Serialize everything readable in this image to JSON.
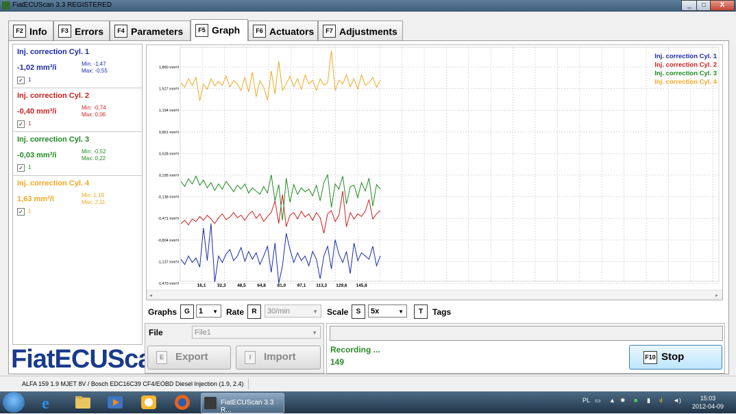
{
  "window": {
    "title": "FiatECUScan 3.3 REGISTERED",
    "minimize": "_",
    "maximize": "□",
    "close": "X"
  },
  "tabs": [
    {
      "key": "F2",
      "label": "Info"
    },
    {
      "key": "F3",
      "label": "Errors"
    },
    {
      "key": "F4",
      "label": "Parameters"
    },
    {
      "key": "F5",
      "label": "Graph",
      "active": true
    },
    {
      "key": "F6",
      "label": "Actuators"
    },
    {
      "key": "F7",
      "label": "Adjustments"
    }
  ],
  "cylinders": [
    {
      "name": "Inj. correction Cyl. 1",
      "value": "-1,02 mm³/i",
      "min": "Min: -1,47",
      "max": "Max: -0,55",
      "graph": "1",
      "color": "#1a2aaa"
    },
    {
      "name": "Inj. correction Cyl. 2",
      "value": "-0,40 mm³/i",
      "min": "Min: -0,74",
      "max": "Max: 0,06",
      "graph": "1",
      "color": "#cc2020"
    },
    {
      "name": "Inj. correction Cyl. 3",
      "value": "-0,03 mm³/i",
      "min": "Min: -0,52",
      "max": "Max: 0,22",
      "graph": "1",
      "color": "#1f8a1f"
    },
    {
      "name": "Inj. correction Cyl. 4",
      "value": "1,63 mm³/i",
      "min": "Min: 1,19",
      "max": "Max: 2,11",
      "graph": "1",
      "color": "#f0a820"
    }
  ],
  "logo": "FiatECUScan",
  "controls": {
    "graphs_label": "Graphs",
    "graphs_key": "G",
    "graphs_value": "1",
    "rate_label": "Rate",
    "rate_key": "R",
    "rate_value": "30/min",
    "scale_label": "Scale",
    "scale_key": "S",
    "scale_value": "5x",
    "tags_key": "T",
    "tags_label": "Tags"
  },
  "file": {
    "label": "File",
    "value": "File1",
    "export_key": "E",
    "export_label": "Export",
    "import_key": "I",
    "import_label": "Import"
  },
  "recording": {
    "text": "Recording ...",
    "count": "149",
    "stop_key": "F10",
    "stop_label": "Stop"
  },
  "status": "ALFA 159 1.9 MJET 8V / Bosch EDC16C39 CF4/EOBD Diesel Injection (1.9, 2.4)",
  "taskbar": {
    "app_label": "FiatECUScan 3.3 R...",
    "lang": "PL",
    "time": "15:03",
    "date": "2012-04-09"
  },
  "chart_data": {
    "type": "line",
    "y_ticks": [
      "1,860 mm³/i",
      "1,527 mm³/i",
      "1,194 mm³/i",
      "0,861 mm³/i",
      "0,528 mm³/i",
      "0,195 mm³/i",
      "-0,138 mm³/i",
      "-0,471 mm³/i",
      "-0,804 mm³/i",
      "-1,137 mm³/i",
      "-1,470 mm³/i"
    ],
    "x_ticks": [
      "16,1",
      "32,3",
      "48,5",
      "64,8",
      "81,0",
      "97,1",
      "113,3",
      "129,6",
      "145,8"
    ],
    "ylim": [
      -1.47,
      2.193
    ],
    "xlim": [
      0,
      600
    ],
    "legend_position": "top-right",
    "grid": true,
    "series": [
      {
        "name": "Inj. correction Cyl. 1",
        "color": "#1a2aaa",
        "values": [
          -1.1,
          -1.18,
          -1.05,
          -1.15,
          -1.08,
          -1.22,
          -0.62,
          -1.12,
          -0.55,
          -1.45,
          -1.05,
          -1.15,
          -1.02,
          -0.95,
          -1.12,
          -1.05,
          -0.92,
          -1.13,
          -0.98,
          -1.1,
          -1.0,
          -1.18,
          -1.05,
          -0.9,
          -1.3,
          -0.85,
          -1.47,
          -1.2,
          -0.7,
          -0.95,
          -1.15,
          -1.0,
          -1.12,
          -1.05,
          -1.2,
          -0.98,
          -1.1,
          -1.4,
          -1.05,
          -0.9,
          -1.25,
          -0.8,
          -1.02,
          -1.15,
          -0.98,
          -1.32,
          -0.85,
          -1.12,
          -1.0,
          -1.05,
          -1.1,
          -0.9,
          -1.2,
          -1.05
        ]
      },
      {
        "name": "Inj. correction Cyl. 2",
        "color": "#cc2020",
        "values": [
          -0.55,
          -0.5,
          -0.57,
          -0.48,
          -0.52,
          -0.44,
          -0.5,
          -0.42,
          -0.48,
          -0.55,
          -0.46,
          -0.4,
          -0.49,
          -0.45,
          -0.38,
          -0.46,
          -0.42,
          -0.5,
          -0.41,
          -0.36,
          -0.47,
          -0.4,
          -0.52,
          -0.44,
          -0.38,
          -0.2,
          -0.55,
          -0.1,
          -0.6,
          -0.42,
          -0.38,
          -0.48,
          -0.36,
          -0.45,
          -0.4,
          -0.5,
          -0.38,
          -0.46,
          -0.7,
          -0.4,
          -0.35,
          -0.52,
          -0.42,
          -0.05,
          -0.6,
          -0.38,
          -0.48,
          -0.4,
          -0.44,
          -0.36,
          -0.18,
          -0.48,
          -0.4,
          -0.35
        ]
      },
      {
        "name": "Inj. correction Cyl. 3",
        "color": "#1f8a1f",
        "values": [
          0.1,
          0.02,
          0.14,
          0.06,
          0.18,
          0.04,
          0.12,
          0.0,
          0.08,
          -0.04,
          0.06,
          -0.02,
          0.1,
          0.02,
          -0.06,
          0.04,
          -0.02,
          0.06,
          -0.08,
          0.0,
          -0.05,
          -0.1,
          0.02,
          -0.08,
          0.2,
          -0.2,
          0.05,
          -0.5,
          0.15,
          -0.22,
          0.05,
          -0.1,
          0.0,
          -0.06,
          -0.02,
          -0.12,
          0.04,
          -0.2,
          0.08,
          0.2,
          -0.3,
          0.06,
          -0.02,
          0.18,
          -0.25,
          0.02,
          0.04,
          -0.15,
          0.08,
          -0.05,
          0.15,
          -0.28,
          0.05,
          -0.02
        ]
      },
      {
        "name": "Inj. correction Cyl. 4",
        "color": "#f0a820",
        "values": [
          1.62,
          1.55,
          1.68,
          1.58,
          1.7,
          1.34,
          1.6,
          1.52,
          1.68,
          1.57,
          1.64,
          1.58,
          1.72,
          1.55,
          1.65,
          1.6,
          1.5,
          1.7,
          1.48,
          1.78,
          1.4,
          1.65,
          1.55,
          1.35,
          1.8,
          1.45,
          1.95,
          1.5,
          1.6,
          1.72,
          1.56,
          1.68,
          1.52,
          1.74,
          1.6,
          1.66,
          1.5,
          1.68,
          1.58,
          1.62,
          2.11,
          1.5,
          1.66,
          1.6,
          1.74,
          1.56,
          1.68,
          1.52,
          1.74,
          1.58,
          1.62,
          1.7,
          1.55,
          1.66
        ]
      }
    ]
  }
}
